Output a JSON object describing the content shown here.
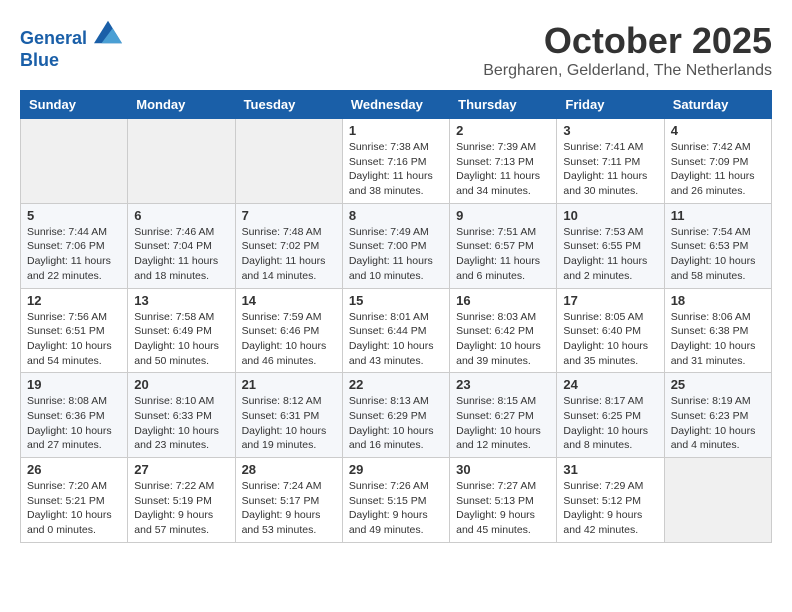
{
  "header": {
    "logo_line1": "General",
    "logo_line2": "Blue",
    "month": "October 2025",
    "location": "Bergharen, Gelderland, The Netherlands"
  },
  "weekdays": [
    "Sunday",
    "Monday",
    "Tuesday",
    "Wednesday",
    "Thursday",
    "Friday",
    "Saturday"
  ],
  "weeks": [
    [
      {
        "day": "",
        "info": ""
      },
      {
        "day": "",
        "info": ""
      },
      {
        "day": "",
        "info": ""
      },
      {
        "day": "1",
        "info": "Sunrise: 7:38 AM\nSunset: 7:16 PM\nDaylight: 11 hours\nand 38 minutes."
      },
      {
        "day": "2",
        "info": "Sunrise: 7:39 AM\nSunset: 7:13 PM\nDaylight: 11 hours\nand 34 minutes."
      },
      {
        "day": "3",
        "info": "Sunrise: 7:41 AM\nSunset: 7:11 PM\nDaylight: 11 hours\nand 30 minutes."
      },
      {
        "day": "4",
        "info": "Sunrise: 7:42 AM\nSunset: 7:09 PM\nDaylight: 11 hours\nand 26 minutes."
      }
    ],
    [
      {
        "day": "5",
        "info": "Sunrise: 7:44 AM\nSunset: 7:06 PM\nDaylight: 11 hours\nand 22 minutes."
      },
      {
        "day": "6",
        "info": "Sunrise: 7:46 AM\nSunset: 7:04 PM\nDaylight: 11 hours\nand 18 minutes."
      },
      {
        "day": "7",
        "info": "Sunrise: 7:48 AM\nSunset: 7:02 PM\nDaylight: 11 hours\nand 14 minutes."
      },
      {
        "day": "8",
        "info": "Sunrise: 7:49 AM\nSunset: 7:00 PM\nDaylight: 11 hours\nand 10 minutes."
      },
      {
        "day": "9",
        "info": "Sunrise: 7:51 AM\nSunset: 6:57 PM\nDaylight: 11 hours\nand 6 minutes."
      },
      {
        "day": "10",
        "info": "Sunrise: 7:53 AM\nSunset: 6:55 PM\nDaylight: 11 hours\nand 2 minutes."
      },
      {
        "day": "11",
        "info": "Sunrise: 7:54 AM\nSunset: 6:53 PM\nDaylight: 10 hours\nand 58 minutes."
      }
    ],
    [
      {
        "day": "12",
        "info": "Sunrise: 7:56 AM\nSunset: 6:51 PM\nDaylight: 10 hours\nand 54 minutes."
      },
      {
        "day": "13",
        "info": "Sunrise: 7:58 AM\nSunset: 6:49 PM\nDaylight: 10 hours\nand 50 minutes."
      },
      {
        "day": "14",
        "info": "Sunrise: 7:59 AM\nSunset: 6:46 PM\nDaylight: 10 hours\nand 46 minutes."
      },
      {
        "day": "15",
        "info": "Sunrise: 8:01 AM\nSunset: 6:44 PM\nDaylight: 10 hours\nand 43 minutes."
      },
      {
        "day": "16",
        "info": "Sunrise: 8:03 AM\nSunset: 6:42 PM\nDaylight: 10 hours\nand 39 minutes."
      },
      {
        "day": "17",
        "info": "Sunrise: 8:05 AM\nSunset: 6:40 PM\nDaylight: 10 hours\nand 35 minutes."
      },
      {
        "day": "18",
        "info": "Sunrise: 8:06 AM\nSunset: 6:38 PM\nDaylight: 10 hours\nand 31 minutes."
      }
    ],
    [
      {
        "day": "19",
        "info": "Sunrise: 8:08 AM\nSunset: 6:36 PM\nDaylight: 10 hours\nand 27 minutes."
      },
      {
        "day": "20",
        "info": "Sunrise: 8:10 AM\nSunset: 6:33 PM\nDaylight: 10 hours\nand 23 minutes."
      },
      {
        "day": "21",
        "info": "Sunrise: 8:12 AM\nSunset: 6:31 PM\nDaylight: 10 hours\nand 19 minutes."
      },
      {
        "day": "22",
        "info": "Sunrise: 8:13 AM\nSunset: 6:29 PM\nDaylight: 10 hours\nand 16 minutes."
      },
      {
        "day": "23",
        "info": "Sunrise: 8:15 AM\nSunset: 6:27 PM\nDaylight: 10 hours\nand 12 minutes."
      },
      {
        "day": "24",
        "info": "Sunrise: 8:17 AM\nSunset: 6:25 PM\nDaylight: 10 hours\nand 8 minutes."
      },
      {
        "day": "25",
        "info": "Sunrise: 8:19 AM\nSunset: 6:23 PM\nDaylight: 10 hours\nand 4 minutes."
      }
    ],
    [
      {
        "day": "26",
        "info": "Sunrise: 7:20 AM\nSunset: 5:21 PM\nDaylight: 10 hours\nand 0 minutes."
      },
      {
        "day": "27",
        "info": "Sunrise: 7:22 AM\nSunset: 5:19 PM\nDaylight: 9 hours\nand 57 minutes."
      },
      {
        "day": "28",
        "info": "Sunrise: 7:24 AM\nSunset: 5:17 PM\nDaylight: 9 hours\nand 53 minutes."
      },
      {
        "day": "29",
        "info": "Sunrise: 7:26 AM\nSunset: 5:15 PM\nDaylight: 9 hours\nand 49 minutes."
      },
      {
        "day": "30",
        "info": "Sunrise: 7:27 AM\nSunset: 5:13 PM\nDaylight: 9 hours\nand 45 minutes."
      },
      {
        "day": "31",
        "info": "Sunrise: 7:29 AM\nSunset: 5:12 PM\nDaylight: 9 hours\nand 42 minutes."
      },
      {
        "day": "",
        "info": ""
      }
    ]
  ]
}
